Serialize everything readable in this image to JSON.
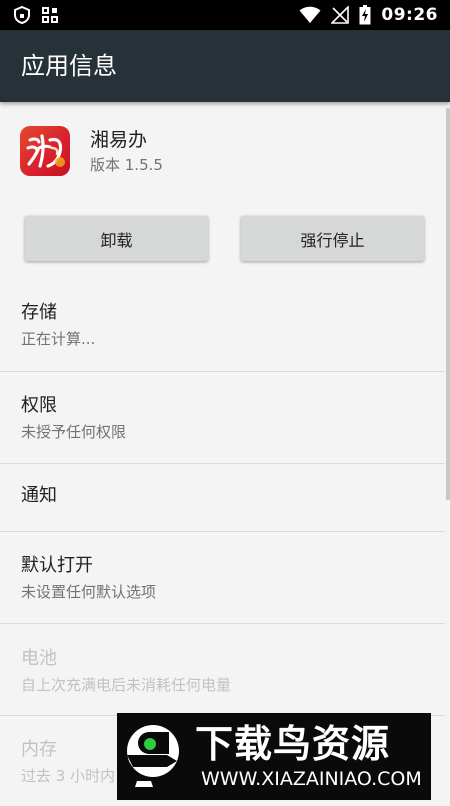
{
  "status_bar": {
    "time": "09:26",
    "icons": [
      "shield-icon",
      "grid-icon",
      "wifi-icon",
      "signal-off-icon",
      "battery-charging-icon"
    ]
  },
  "app_bar": {
    "title": "应用信息",
    "background": "#263238"
  },
  "app": {
    "name": "湘易办",
    "version": "版本 1.5.5",
    "icon": "app-logo-icon",
    "icon_color": "#d91f2e"
  },
  "buttons": {
    "uninstall": "卸载",
    "force_stop": "强行停止"
  },
  "items": [
    {
      "title": "存储",
      "summary": "正在计算...",
      "disabled": false
    },
    {
      "title": "权限",
      "summary": "未授予任何权限",
      "disabled": false
    },
    {
      "title": "通知",
      "summary": "",
      "disabled": false
    },
    {
      "title": "默认打开",
      "summary": "未设置任何默认选项",
      "disabled": false
    },
    {
      "title": "电池",
      "summary": "自上次充满电后未消耗任何电量",
      "disabled": true
    },
    {
      "title": "内存",
      "summary": "过去 3 小时内",
      "disabled": true
    }
  ],
  "watermark": {
    "title": "下载鸟资源",
    "url": "WWW.XIAZAINIAO.COM"
  }
}
